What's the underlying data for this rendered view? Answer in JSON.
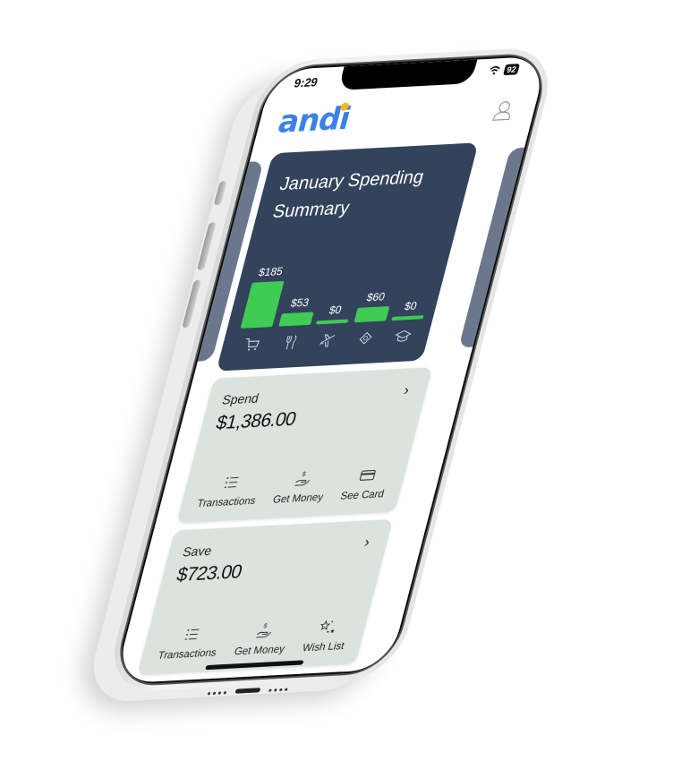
{
  "status_bar": {
    "time": "9:29",
    "battery": "92",
    "wifi_icon": "wifi-icon"
  },
  "header": {
    "logo": "andi",
    "brand_color": "#3b82e6",
    "logo_dot_color": "#f6b91a",
    "profile_icon": "user-icon"
  },
  "summary": {
    "title": "January Spending Summary",
    "card_color": "#33435c",
    "bar_color": "#3fcb54",
    "categories": [
      {
        "name": "Shopping",
        "icon": "cart-icon",
        "label": "$185",
        "value": 185
      },
      {
        "name": "Dining",
        "icon": "utensils-icon",
        "label": "$53",
        "value": 53
      },
      {
        "name": "Travel",
        "icon": "airplane-icon",
        "label": "$0",
        "value": 0
      },
      {
        "name": "Bills",
        "icon": "money-icon",
        "label": "$60",
        "value": 60
      },
      {
        "name": "Education",
        "icon": "graduation-cap-icon",
        "label": "$0",
        "value": 0
      }
    ]
  },
  "chart_data": {
    "type": "bar",
    "title": "January Spending Summary",
    "categories": [
      "Shopping",
      "Dining",
      "Travel",
      "Bills",
      "Education"
    ],
    "values": [
      185,
      53,
      0,
      60,
      0
    ],
    "data_labels": [
      "$185",
      "$53",
      "$0",
      "$60",
      "$0"
    ],
    "xlabel": "",
    "ylabel": "",
    "ylim": [
      0,
      185
    ]
  },
  "accounts": [
    {
      "name": "Spend",
      "amount": "$1,386.00",
      "actions": [
        {
          "label": "Transactions",
          "icon": "list-icon"
        },
        {
          "label": "Get Money",
          "icon": "money-hand-icon"
        },
        {
          "label": "See Card",
          "icon": "credit-card-icon"
        }
      ]
    },
    {
      "name": "Save",
      "amount": "$723.00",
      "actions": [
        {
          "label": "Transactions",
          "icon": "list-icon"
        },
        {
          "label": "Get Money",
          "icon": "money-hand-icon"
        },
        {
          "label": "Wish List",
          "icon": "stars-icon"
        }
      ]
    }
  ],
  "card_bg_color": "#dbe3de"
}
